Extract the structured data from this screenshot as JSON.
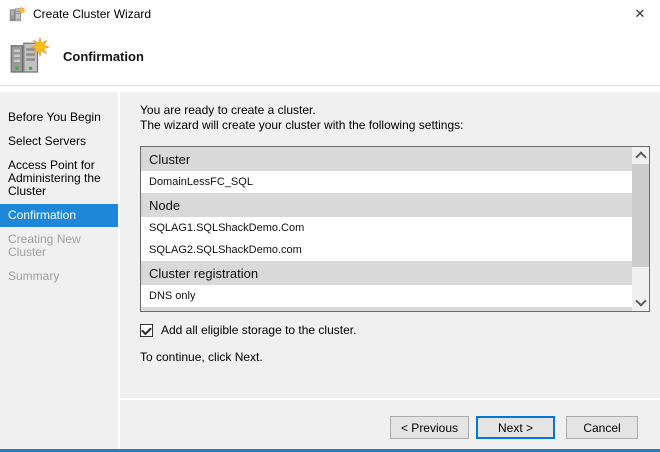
{
  "window": {
    "title": "Create Cluster Wizard"
  },
  "icons": {
    "close": "✕",
    "app_icon": "server-stack-with-star",
    "scroll_up": "chevron-up",
    "scroll_down": "chevron-down"
  },
  "header": {
    "title": "Confirmation"
  },
  "sidebar": {
    "items": [
      {
        "label": "Before You Begin",
        "state": "normal"
      },
      {
        "label": "Select Servers",
        "state": "normal"
      },
      {
        "label": "Access Point for Administering the Cluster",
        "state": "normal"
      },
      {
        "label": "Confirmation",
        "state": "active"
      },
      {
        "label": "Creating New Cluster",
        "state": "disabled"
      },
      {
        "label": "Summary",
        "state": "disabled"
      }
    ]
  },
  "main": {
    "intro_line1": "You are ready to create a cluster.",
    "intro_line2": "The wizard will create your cluster with the following settings:",
    "settings": [
      {
        "type": "header",
        "text": "Cluster"
      },
      {
        "type": "value",
        "text": "DomainLessFC_SQL"
      },
      {
        "type": "header",
        "text": "Node"
      },
      {
        "type": "value",
        "text": "SQLAG1.SQLShackDemo.Com"
      },
      {
        "type": "value",
        "text": "SQLAG2.SQLShackDemo.com"
      },
      {
        "type": "header",
        "text": "Cluster registration"
      },
      {
        "type": "value",
        "text": "DNS only"
      }
    ],
    "checkbox": {
      "checked": true,
      "label": "Add all eligible storage to the cluster."
    },
    "continue_text": "To continue, click Next."
  },
  "footer": {
    "buttons": [
      {
        "label": "< Previous",
        "style": "normal"
      },
      {
        "label": "Next >",
        "style": "primary"
      },
      {
        "label": "Cancel",
        "style": "cancel"
      }
    ]
  },
  "colors": {
    "selected_step_bg": "#1e87d8",
    "window_bottom_accent": "#2f7cb5",
    "section_header_bg": "#d9d9d9",
    "focus_button_border": "#0078d7"
  }
}
